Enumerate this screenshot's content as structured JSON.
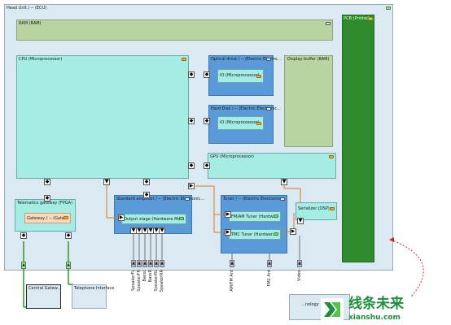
{
  "ecu": {
    "label": "Head Unit / -- (ECU)"
  },
  "ram": {
    "label": "RAM (RAM)"
  },
  "cpu": {
    "label": "CPU (Microprocessor)"
  },
  "optical": {
    "label": "Optical drive / -- (Electric Electro...",
    "io_label": "IO (Microprocessor)"
  },
  "harddisk": {
    "label": "Hard Disk / -- (Electric Electronic...",
    "io_label": "IO (Microprocessor)"
  },
  "display_buffer": {
    "label": "Display buffer (RAM)"
  },
  "gpu": {
    "label": "GPU (Microprocessor)"
  },
  "telematics": {
    "label": "Telematics gateway (FPGA)",
    "gateway_label": "Gateway / -- (Gate..."
  },
  "amp": {
    "label": "Standard amplifier / -- (Electric Electronic...",
    "stage_label": "Output stage (Hardware Mo..."
  },
  "tuner": {
    "label": "Tuner / -- (Electric Electronic...",
    "fmam_label": "FM/AM Tuner (Hardw...",
    "tmc_label": "TMC Tuner (Hardwar..."
  },
  "serializer": {
    "label": "Serializer (DSP)"
  },
  "pcb": {
    "label": "PCB (Printed ..."
  },
  "central_gateway": {
    "label": "Central Gatew..."
  },
  "telephone": {
    "label": "Telephone Interface"
  },
  "bottom_right": {
    "label": "...nology"
  },
  "pins": [
    "SpeakerFL",
    "SpeakerFR",
    "BassL",
    "BassR",
    "SpeakerRL",
    "SpeakerRR",
    "AM/FM Ant",
    "FM2 Ant",
    "Video"
  ],
  "watermark": {
    "main": "线条未来",
    "sub": "xianshu.com"
  }
}
